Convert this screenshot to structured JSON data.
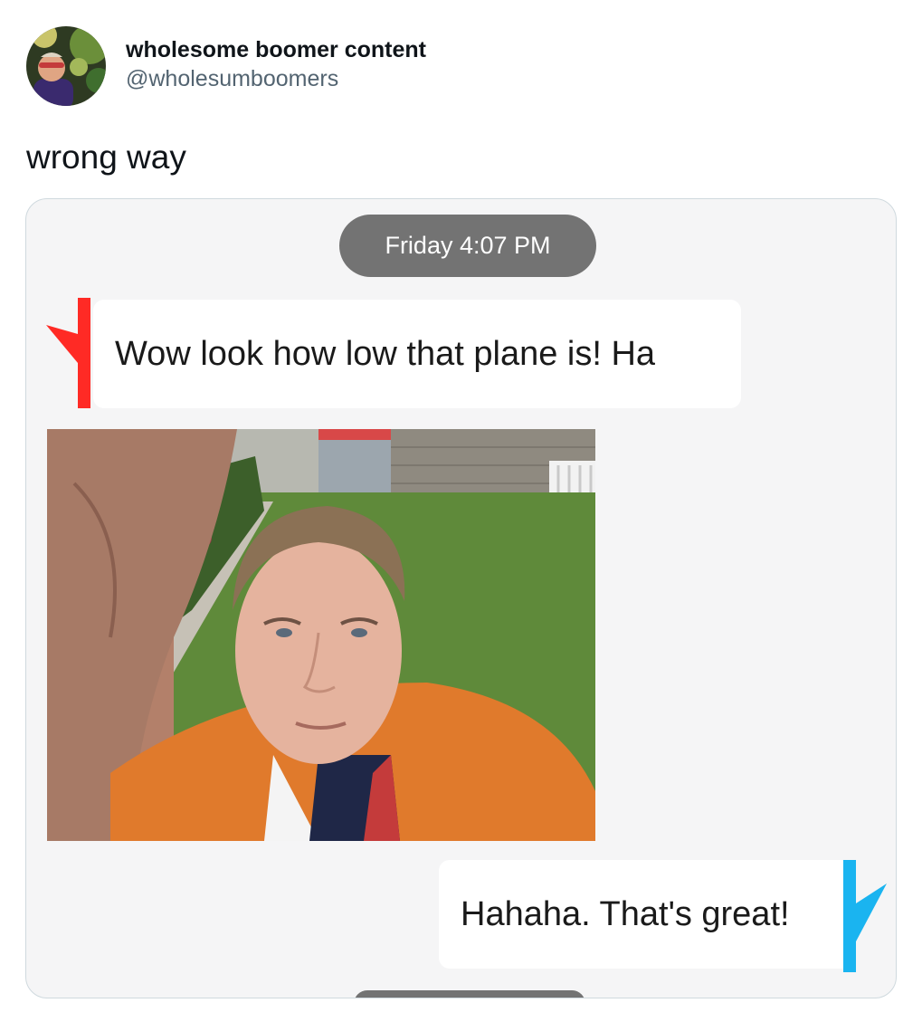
{
  "tweet": {
    "display_name": "wholesome boomer content",
    "handle": "@wholesumboomers",
    "text": "wrong way"
  },
  "chat": {
    "timestamp": "Friday 4:07 PM",
    "incoming_message": "Wow look how low that plane is! Ha",
    "outgoing_message": "Hahaha. That's great!"
  },
  "colors": {
    "incoming_tail": "#ff2a25",
    "outgoing_tail": "#1ab4f0",
    "timestamp_pill": "#737373",
    "chat_background": "#f5f5f6",
    "handle_gray": "#536471"
  },
  "icons": {
    "avatar": "profile-photo",
    "incoming_tail": "red-speech-tail-icon",
    "outgoing_tail": "blue-speech-tail-icon"
  }
}
